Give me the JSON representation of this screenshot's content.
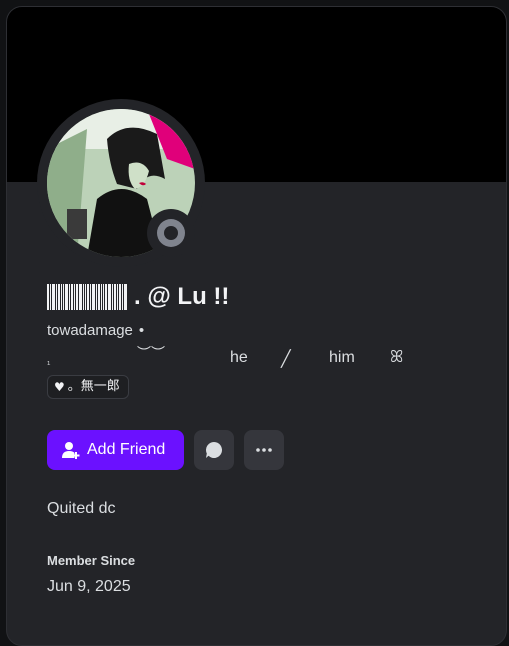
{
  "profile": {
    "display_name_suffix": ". @ Lu !!",
    "username": "towadamage",
    "username_separator": "•",
    "pronouns": {
      "prefix": "₁",
      "deco": "︶︶",
      "he": "he",
      "slash": "╱",
      "him": "him",
      "end": "ꕤ"
    },
    "badge": {
      "heart": "♥",
      "text": "。無一郎"
    },
    "status": "offline",
    "status_color": "#80848e"
  },
  "actions": {
    "add_friend_label": "Add Friend",
    "message_icon": "chat-bubble-icon",
    "more_icon": "more-dots-icon",
    "accent": "#6b11ff"
  },
  "about": {
    "bio": "Quited dc",
    "member_since_label": "Member Since",
    "member_since_value": "Jun 9, 2025"
  }
}
